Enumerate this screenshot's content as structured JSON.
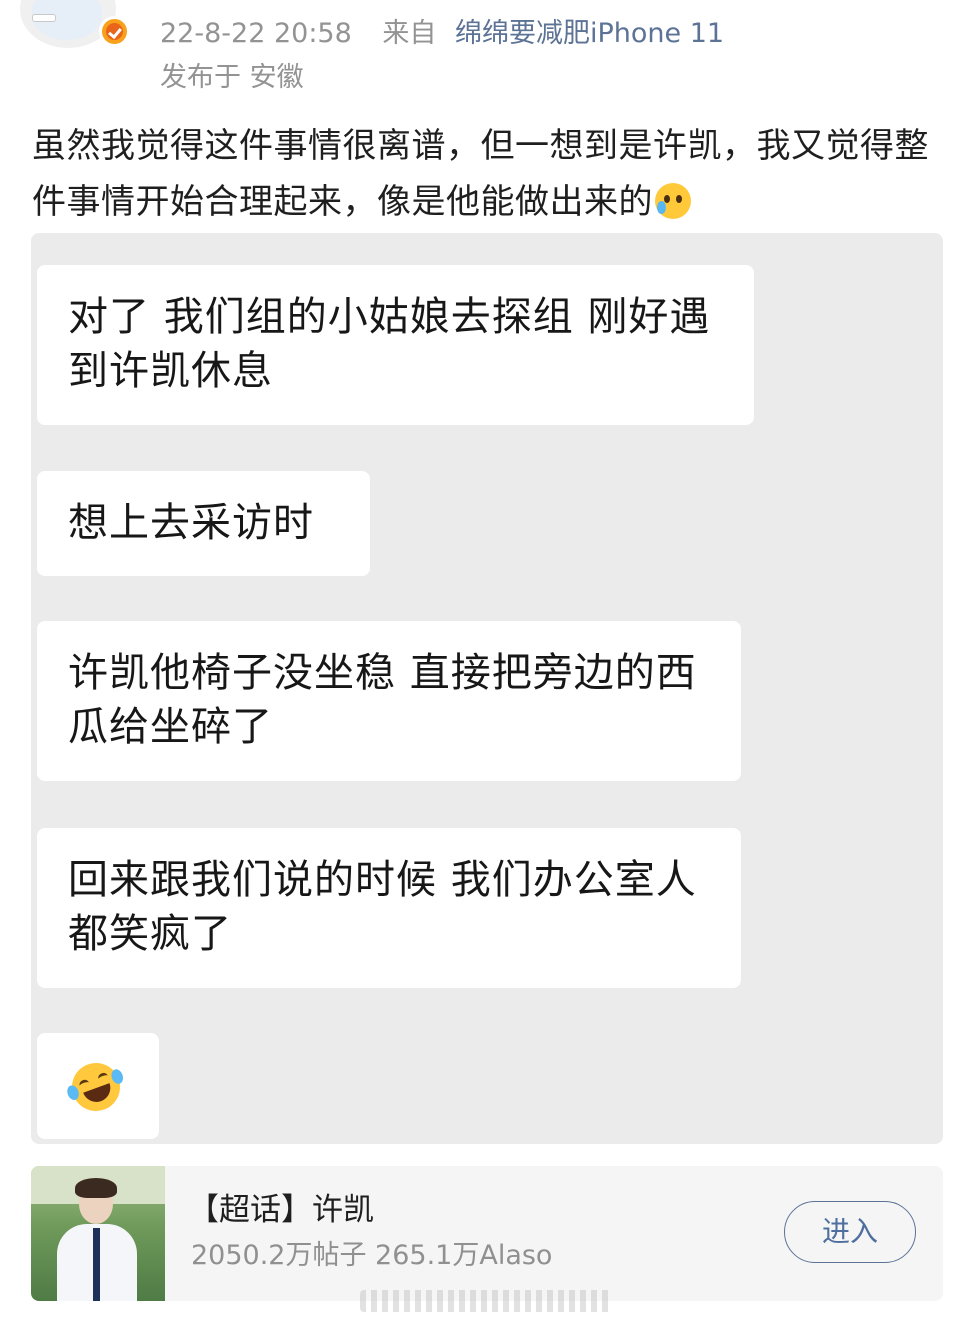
{
  "post": {
    "time": "22-8-22 20:58",
    "from_label": "来自",
    "device": "绵绵要减肥iPhone 11",
    "location": "发布于 安徽",
    "text": "虽然我觉得这件事情很离谱，但一想到是许凯，我又觉得整件事情开始合理起来，像是他能做出来的",
    "icons": {
      "avatar": "cartoon-avatar",
      "verified": "verified-badge-icon",
      "inline_emoji": "sweat-crying-face-emoji"
    }
  },
  "chat": {
    "messages": [
      "对了 我们组的小姑娘去探组 刚好遇到许凯休息",
      "想上去采访时",
      "许凯他椅子没坐稳 直接把旁边的西瓜给坐碎了",
      "回来跟我们说的时候 我们办公室人都笑疯了"
    ],
    "emoji_message": "rolling-on-floor-laughing-emoji"
  },
  "topic": {
    "title": "【超话】许凯",
    "stats": "2050.2万帖子 265.1万Alaso",
    "enter_label": "进入"
  },
  "colors": {
    "meta_gray": "#939393",
    "link_blue": "#5c7396",
    "chat_bg": "#ebebeb",
    "bubble_bg": "#ffffff",
    "badge_orange": "#f8a21c"
  }
}
